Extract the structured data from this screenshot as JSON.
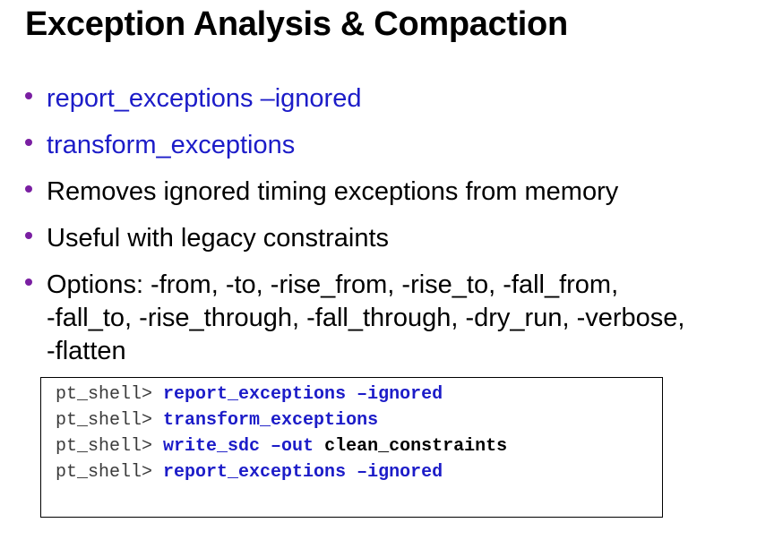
{
  "title": "Exception Analysis & Compaction",
  "colors": {
    "bullet_dot": "#7a1fa2",
    "command_blue": "#1c1cc8",
    "text_black": "#000000"
  },
  "bullets": [
    {
      "text": "report_exceptions –ignored",
      "style": "blue"
    },
    {
      "text": "transform_exceptions",
      "style": "blue"
    },
    {
      "text": "Removes ignored timing exceptions from memory",
      "style": "black"
    },
    {
      "text": "Useful with legacy constraints",
      "style": "black"
    },
    {
      "style": "black",
      "lines": [
        "Options:  -from, -to, -rise_from, -rise_to, -fall_from,",
        "-fall_to, -rise_through, -fall_through, -dry_run, -verbose,",
        "-flatten"
      ]
    }
  ],
  "code": [
    {
      "prompt": "pt_shell> ",
      "command": "report_exceptions –ignored",
      "arg": ""
    },
    {
      "prompt": "pt_shell> ",
      "command": "transform_exceptions",
      "arg": ""
    },
    {
      "prompt": "pt_shell> ",
      "command": "write_sdc –out",
      "arg": " clean_constraints"
    },
    {
      "prompt": "pt_shell> ",
      "command": "report_exceptions –ignored",
      "arg": ""
    }
  ]
}
